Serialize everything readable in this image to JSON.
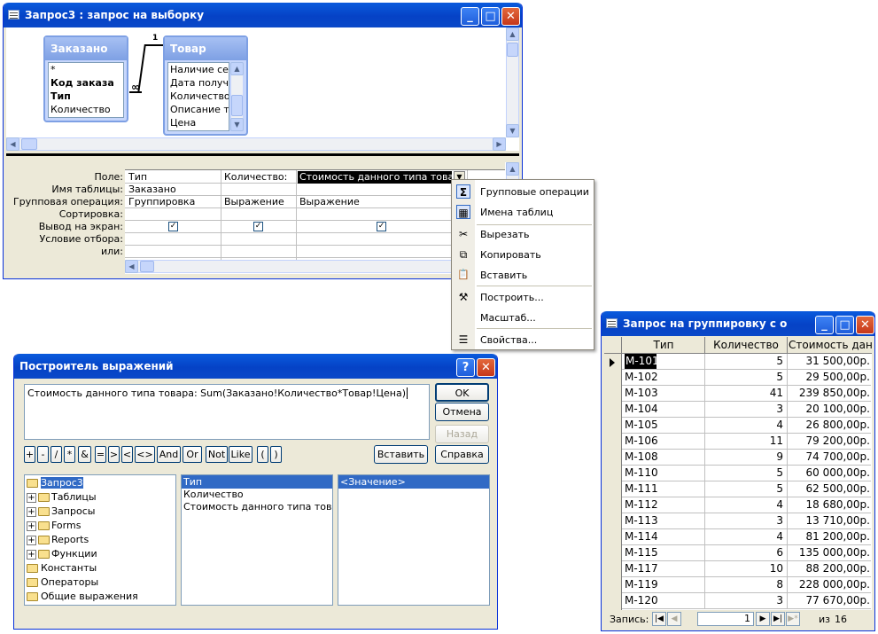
{
  "query_window": {
    "title": "Запрос3 : запрос на выборку",
    "table_zakazano": {
      "title": "Заказано",
      "fields": [
        "*",
        "Код заказа",
        "Тип",
        "Количество"
      ]
    },
    "table_tovar": {
      "title": "Товар",
      "fields": [
        "Наличие сер",
        "Дата получе",
        "Количество",
        "Описание то",
        "Цена"
      ]
    },
    "join_one": "1",
    "join_many": "∞",
    "row_labels": [
      "Поле:",
      "Имя таблицы:",
      "Групповая операция:",
      "Сортировка:",
      "Вывод на экран:",
      "Условие отбора:",
      "или:"
    ],
    "columns": [
      {
        "field": "Тип",
        "table": "Заказано",
        "group": "Группировка",
        "show": true
      },
      {
        "field": "Количество:",
        "table": "",
        "group": "Выражение",
        "show": true
      },
      {
        "field": "Стоимость данного типа товара:",
        "table": "",
        "group": "Выражение",
        "show": true
      }
    ]
  },
  "context_menu": {
    "items": [
      {
        "label": "Групповые операции",
        "icon": "Σ"
      },
      {
        "label": "Имена таблиц",
        "icon": "▦"
      },
      {
        "label": "Вырезать",
        "icon": "✂"
      },
      {
        "label": "Копировать",
        "icon": "⧉"
      },
      {
        "label": "Вставить",
        "icon": "📋"
      },
      {
        "label": "Построить...",
        "icon": "⚒"
      },
      {
        "label": "Масштаб...",
        "icon": ""
      },
      {
        "label": "Свойства...",
        "icon": "☰"
      }
    ]
  },
  "builder": {
    "title": "Построитель выражений",
    "expression": "Стоимость данного типа товара: Sum(Заказано!Количество*Товар!Цена)",
    "buttons": {
      "ok": "OK",
      "cancel": "Отмена",
      "back": "Назад",
      "insert": "Вставить",
      "help": "Справка"
    },
    "operators": [
      "+",
      "-",
      "/",
      "*",
      "&",
      "=",
      ">",
      "<",
      "<>",
      "And",
      "Or",
      "Not",
      "Like",
      "(",
      ")"
    ],
    "tree": [
      {
        "label": "Запрос3",
        "plus": false,
        "selected": true
      },
      {
        "label": "Таблицы",
        "plus": true
      },
      {
        "label": "Запросы",
        "plus": true
      },
      {
        "label": "Forms",
        "plus": true
      },
      {
        "label": "Reports",
        "plus": true
      },
      {
        "label": "Функции",
        "plus": true
      },
      {
        "label": "Константы",
        "plus": false
      },
      {
        "label": "Операторы",
        "plus": false
      },
      {
        "label": "Общие выражения",
        "plus": false
      }
    ],
    "fields": [
      "Тип",
      "Количество",
      "Стоимость данного типа товара"
    ],
    "values": [
      "<Значение>"
    ]
  },
  "result_window": {
    "title": "Запрос на группировку с обоб...",
    "headers": [
      "Тип",
      "Количество",
      "Стоимость дан"
    ],
    "rows": [
      [
        "М-101",
        "5",
        "31 500,00р."
      ],
      [
        "М-102",
        "5",
        "29 500,00р."
      ],
      [
        "М-103",
        "41",
        "239 850,00р."
      ],
      [
        "М-104",
        "3",
        "20 100,00р."
      ],
      [
        "М-105",
        "4",
        "26 800,00р."
      ],
      [
        "М-106",
        "11",
        "79 200,00р."
      ],
      [
        "М-108",
        "9",
        "74 700,00р."
      ],
      [
        "М-110",
        "5",
        "60 000,00р."
      ],
      [
        "М-111",
        "5",
        "62 500,00р."
      ],
      [
        "М-112",
        "4",
        "18 680,00р."
      ],
      [
        "М-113",
        "3",
        "13 710,00р."
      ],
      [
        "М-114",
        "4",
        "81 200,00р."
      ],
      [
        "М-115",
        "6",
        "135 000,00р."
      ],
      [
        "М-117",
        "10",
        "88 200,00р."
      ],
      [
        "М-119",
        "8",
        "228 000,00р."
      ],
      [
        "М-120",
        "3",
        "77 670,00р."
      ]
    ],
    "record_label": "Запись:",
    "record_current": "1",
    "record_of": "из",
    "record_total": "16"
  },
  "colors": {
    "title_blue": "#0542c6",
    "window_bg": "#ece9d8",
    "selection": "#316ac5",
    "close_red": "#c6381a"
  }
}
